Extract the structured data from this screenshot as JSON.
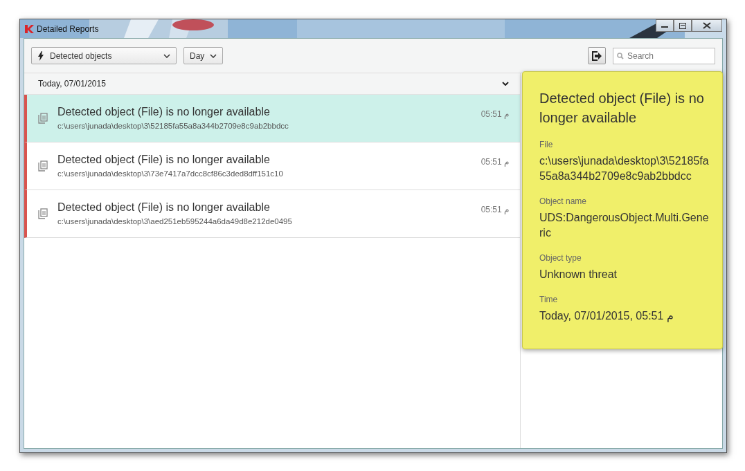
{
  "window": {
    "title": "Detailed Reports"
  },
  "toolbar": {
    "report_type": "Detected objects",
    "period": "Day",
    "search": {
      "placeholder": "Search"
    }
  },
  "group": {
    "label": "Today, 07/01/2015",
    "expanded": true
  },
  "events": [
    {
      "title": "Detected object (File) is no longer available",
      "path": "c:\\users\\junada\\desktop\\3\\52185fa55a8a344b2709e8c9ab2bbdcc",
      "time": "05:51 م",
      "selected": true
    },
    {
      "title": "Detected object (File) is no longer available",
      "path": "c:\\users\\junada\\desktop\\3\\73e7417a7dcc8cf86c3ded8dff151c10",
      "time": "05:51 م",
      "selected": false
    },
    {
      "title": "Detected object (File) is no longer available",
      "path": "c:\\users\\junada\\desktop\\3\\aed251eb595244a6da49d8e212de0495",
      "time": "05:51 م",
      "selected": false
    }
  ],
  "details": {
    "title": "Detected object (File) is no longer available",
    "fields": [
      {
        "label": "File",
        "value": "c:\\users\\junada\\desktop\\3\\52185fa55a8a344b2709e8c9ab2bbdcc"
      },
      {
        "label": "Object name",
        "value": "UDS:DangerousObject.Multi.Generic"
      },
      {
        "label": "Object type",
        "value": "Unknown threat"
      },
      {
        "label": "Time",
        "value": "Today, 07/01/2015, 05:51 م"
      }
    ]
  }
}
